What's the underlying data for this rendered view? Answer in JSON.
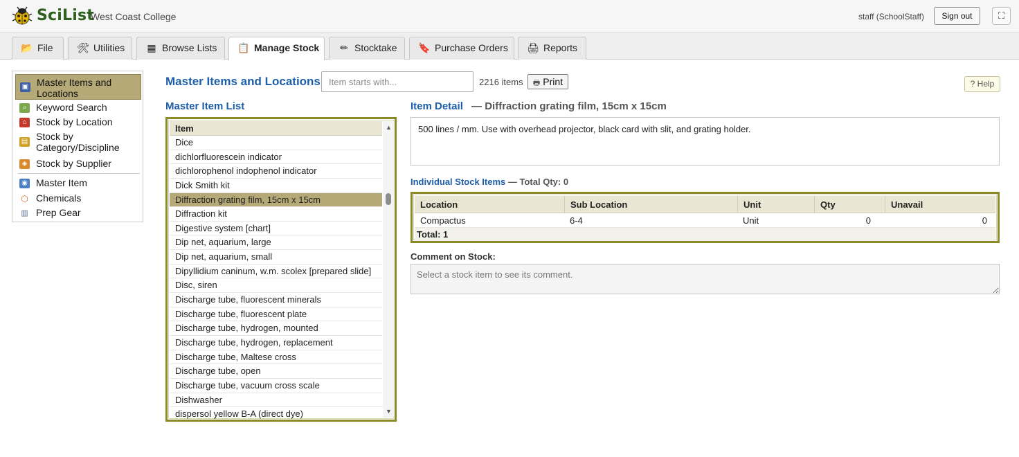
{
  "header": {
    "app_name": "SciList",
    "school_name": "West Coast College",
    "user_label": "staff (SchoolStaff)",
    "signout_label": "Sign out",
    "fullscreen_glyph": "⛶"
  },
  "tabs": [
    {
      "label": "File",
      "icon": "folder-icon",
      "glyph": "📂"
    },
    {
      "label": "Utilities",
      "icon": "tools-icon",
      "glyph": "🛠"
    },
    {
      "label": "Browse Lists",
      "icon": "table-icon",
      "glyph": "▦"
    },
    {
      "label": "Manage Stock",
      "icon": "clipboard-icon",
      "glyph": "📋",
      "active": true
    },
    {
      "label": "Stocktake",
      "icon": "pencil-icon",
      "glyph": "✏"
    },
    {
      "label": "Purchase Orders",
      "icon": "order-icon",
      "glyph": "🔖"
    },
    {
      "label": "Reports",
      "icon": "printer-icon",
      "glyph": "🖨"
    }
  ],
  "sidebar": {
    "items": [
      {
        "label": "Master Items and Locations",
        "icon": "map-icon",
        "active": true
      },
      {
        "label": "Keyword Search",
        "icon": "search-icon"
      },
      {
        "label": "Stock by Location",
        "icon": "location-icon"
      },
      {
        "label": "Stock by Category/Discipline",
        "icon": "category-icon"
      },
      {
        "label": "Stock by Supplier",
        "icon": "supplier-icon"
      },
      {
        "label": "Master Item",
        "icon": "master-item-icon"
      },
      {
        "label": "Chemicals",
        "icon": "chemicals-icon"
      },
      {
        "label": "Prep Gear",
        "icon": "prep-gear-icon"
      }
    ]
  },
  "main": {
    "title": "Master Items and Locations",
    "search_placeholder": "Item starts with...",
    "item_count": "2216 items",
    "print_label": "Print",
    "help_label": "? Help"
  },
  "master_list": {
    "heading": "Master Item List",
    "column": "Item",
    "items": [
      "Dice",
      "dichlorfluorescein indicator",
      "dichlorophenol indophenol indicator",
      "Dick Smith kit",
      "Diffraction grating film, 15cm x 15cm",
      "Diffraction kit",
      "Digestive system [chart]",
      "Dip net, aquarium, large",
      "Dip net, aquarium, small",
      "Dipyllidium caninum, w.m. scolex [prepared slide]",
      "Disc, siren",
      "Discharge tube, fluorescent minerals",
      "Discharge tube, fluorescent plate",
      "Discharge tube, hydrogen, mounted",
      "Discharge tube, hydrogen, replacement",
      "Discharge tube, Maltese cross",
      "Discharge tube, open",
      "Discharge tube, vacuum cross scale",
      "Dishwasher",
      "dispersol yellow B-A (direct dye)"
    ],
    "selected_index": 4
  },
  "detail": {
    "label": "Item Detail",
    "separator": "—",
    "item_name": "Diffraction grating film, 15cm x 15cm",
    "description": "500 lines / mm. Use with overhead projector, black card with slit, and grating holder."
  },
  "stock": {
    "label": "Individual Stock Items",
    "total_qty": "— Total Qty: 0",
    "columns": [
      "Location",
      "Sub Location",
      "Unit",
      "Qty",
      "Unavail"
    ],
    "rows": [
      {
        "location": "Compactus",
        "sub_location": "6-4",
        "unit": "Unit",
        "qty": "0",
        "unavail": "0"
      }
    ],
    "footer": "Total: 1"
  },
  "comment": {
    "label": "Comment on Stock:",
    "placeholder": "Select a stock item to see its comment."
  },
  "colors": {
    "brand_green": "#2f5f1e",
    "heading_blue": "#1d5ea8",
    "selected_row": "#b5a978",
    "frame_olive": "#8a8a26"
  }
}
